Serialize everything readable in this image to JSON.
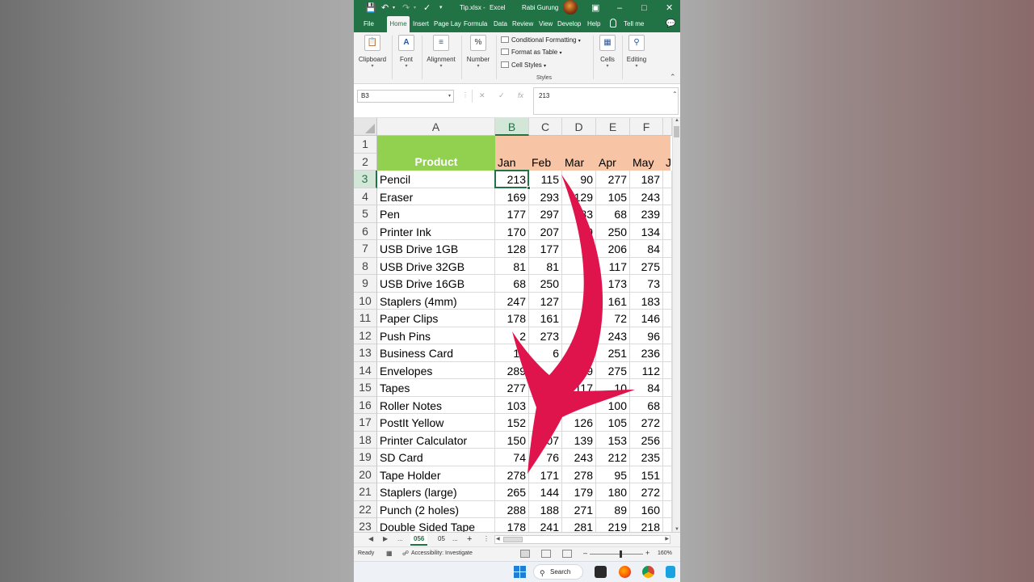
{
  "window": {
    "filename": "Tip.xlsx",
    "separator": "-",
    "app": "Excel",
    "user": "Rabi Gurung"
  },
  "tabs": [
    "File",
    "Home",
    "Insert",
    "Page Lay",
    "Formula",
    "Data",
    "Review",
    "View",
    "Develop",
    "Help",
    "Tell me"
  ],
  "active_tab": "Home",
  "ribbon": {
    "clipboard": "Clipboard",
    "font": "Font",
    "alignment": "Alignment",
    "number": "Number",
    "number_icon": "%",
    "conditional_formatting": "Conditional Formatting",
    "format_as_table": "Format as Table",
    "cell_styles": "Cell Styles",
    "styles": "Styles",
    "cells": "Cells",
    "editing": "Editing"
  },
  "formula_bar": {
    "name_box": "B3",
    "fx_label": "fx",
    "formula": "213"
  },
  "sheet": {
    "columns": [
      "A",
      "B",
      "C",
      "D",
      "E",
      "F"
    ],
    "rows": [
      "1",
      "2",
      "3",
      "4",
      "5",
      "6",
      "7",
      "8",
      "9",
      "10",
      "11",
      "12",
      "13",
      "14",
      "15",
      "16",
      "17",
      "18",
      "19",
      "20",
      "21",
      "22",
      "23"
    ],
    "header": {
      "product": "Product",
      "months": [
        "Jan",
        "Feb",
        "Mar",
        "Apr",
        "May",
        "Ju"
      ]
    },
    "data": [
      [
        "Pencil",
        "213",
        "115",
        "90",
        "277",
        "187"
      ],
      [
        "Eraser",
        "169",
        "293",
        "129",
        "105",
        "243"
      ],
      [
        "Pen",
        "177",
        "297",
        "83",
        "68",
        "239"
      ],
      [
        "Printer Ink",
        "170",
        "207",
        "9",
        "250",
        "134"
      ],
      [
        "USB Drive 1GB",
        "128",
        "177",
        "",
        "206",
        "84"
      ],
      [
        "USB Drive 32GB",
        "81",
        "81",
        "",
        "117",
        "275"
      ],
      [
        "USB Drive 16GB",
        "68",
        "250",
        "",
        "173",
        "73"
      ],
      [
        "Staplers (4mm)",
        "247",
        "127",
        "",
        "161",
        "183"
      ],
      [
        "Paper Clips",
        "178",
        "161",
        "",
        "72",
        "146"
      ],
      [
        "Push Pins",
        "2",
        "273",
        "",
        "243",
        "96"
      ],
      [
        "Business Card",
        "13",
        "6",
        "",
        "251",
        "236"
      ],
      [
        "Envelopes",
        "289",
        "",
        "59",
        "275",
        "112"
      ],
      [
        "Tapes",
        "277",
        "",
        "117",
        "10",
        "84"
      ],
      [
        "Roller Notes",
        "103",
        "",
        "",
        "100",
        "68"
      ],
      [
        "PostIt Yellow",
        "152",
        "",
        "126",
        "105",
        "272"
      ],
      [
        "Printer Calculator",
        "150",
        "07",
        "139",
        "153",
        "256"
      ],
      [
        "SD Card",
        "74",
        "76",
        "243",
        "212",
        "235"
      ],
      [
        "Tape Holder",
        "278",
        "171",
        "278",
        "95",
        "151"
      ],
      [
        "Staplers (large)",
        "265",
        "144",
        "179",
        "180",
        "272"
      ],
      [
        "Punch (2 holes)",
        "288",
        "188",
        "271",
        "89",
        "160"
      ],
      [
        "Double Sided Tape",
        "178",
        "241",
        "281",
        "219",
        "218"
      ]
    ]
  },
  "sheet_tabs": {
    "ellipsis_left": "...",
    "active": "056",
    "next": "05",
    "ellipsis_right": "...",
    "add": "+"
  },
  "status": {
    "ready": "Ready",
    "accessibility": "Accessibility: Investigate",
    "zoom": "160%"
  },
  "taskbar": {
    "search": "Search"
  },
  "colors": {
    "excel_green": "#217346",
    "product_header": "#92d050",
    "month_header": "#f7c4a5",
    "arrow": "#e0144c"
  }
}
